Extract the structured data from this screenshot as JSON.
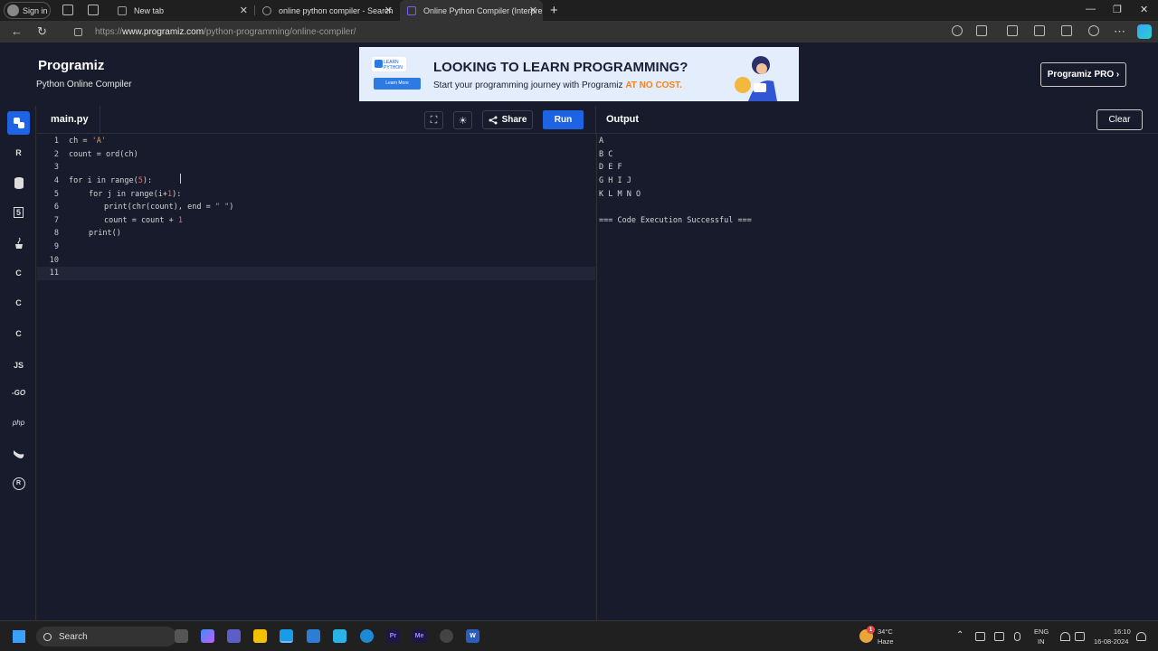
{
  "browser": {
    "signin_label": "Sign in",
    "tabs": [
      {
        "label": "New tab"
      },
      {
        "label": "online python compiler - Search"
      },
      {
        "label": "Online Python Compiler (Interpre"
      }
    ],
    "new_tab_glyph": "+",
    "close_glyph": "✕",
    "url_prefix": "https://",
    "url_host": "www.programiz.com",
    "url_path": "/python-programming/online-compiler/"
  },
  "header": {
    "logo": "Programiz",
    "subtitle": "Python Online Compiler",
    "pro_button": "Programiz PRO ›"
  },
  "banner": {
    "badge": "LEARN PYTHON",
    "learn_more": "Learn More",
    "headline": "LOOKING TO LEARN PROGRAMMING?",
    "sub_text": "Start your programming journey with Programiz ",
    "sub_highlight": "AT NO COST."
  },
  "sidebar": {
    "languages": [
      {
        "name": "python",
        "label": ""
      },
      {
        "name": "r",
        "label": "R"
      },
      {
        "name": "sql",
        "label": ""
      },
      {
        "name": "html",
        "label": "5"
      },
      {
        "name": "java",
        "label": ""
      },
      {
        "name": "c",
        "label": "C"
      },
      {
        "name": "cpp",
        "label": "C"
      },
      {
        "name": "csharp",
        "label": "C"
      },
      {
        "name": "js",
        "label": "JS"
      },
      {
        "name": "go",
        "label": "-GO"
      },
      {
        "name": "php",
        "label": "php"
      },
      {
        "name": "swift",
        "label": ""
      },
      {
        "name": "rust",
        "label": "R"
      }
    ]
  },
  "toolbar": {
    "file_name": "main.py",
    "share_label": "Share",
    "run_label": "Run",
    "output_label": "Output",
    "clear_label": "Clear"
  },
  "editor": {
    "line_numbers": [
      "1",
      "2",
      "3",
      "4",
      "5",
      "6",
      "7",
      "8",
      "9",
      "10",
      "11"
    ]
  },
  "output": {
    "lines": [
      "A",
      "B C",
      "D E F",
      "G H I J",
      "K L M N O",
      "",
      "=== Code Execution Successful ==="
    ]
  },
  "taskbar": {
    "search_label": "Search",
    "weather_temp": "34°C",
    "weather_desc": "Haze",
    "weather_badge": "1",
    "lang_top": "ENG",
    "lang_bottom": "IN",
    "time": "16:10",
    "date": "16-08-2024"
  },
  "colors": {
    "accent": "#1f63e5",
    "background": "#181b2b",
    "string": "#c9a27a",
    "number": "#e06c6c"
  }
}
